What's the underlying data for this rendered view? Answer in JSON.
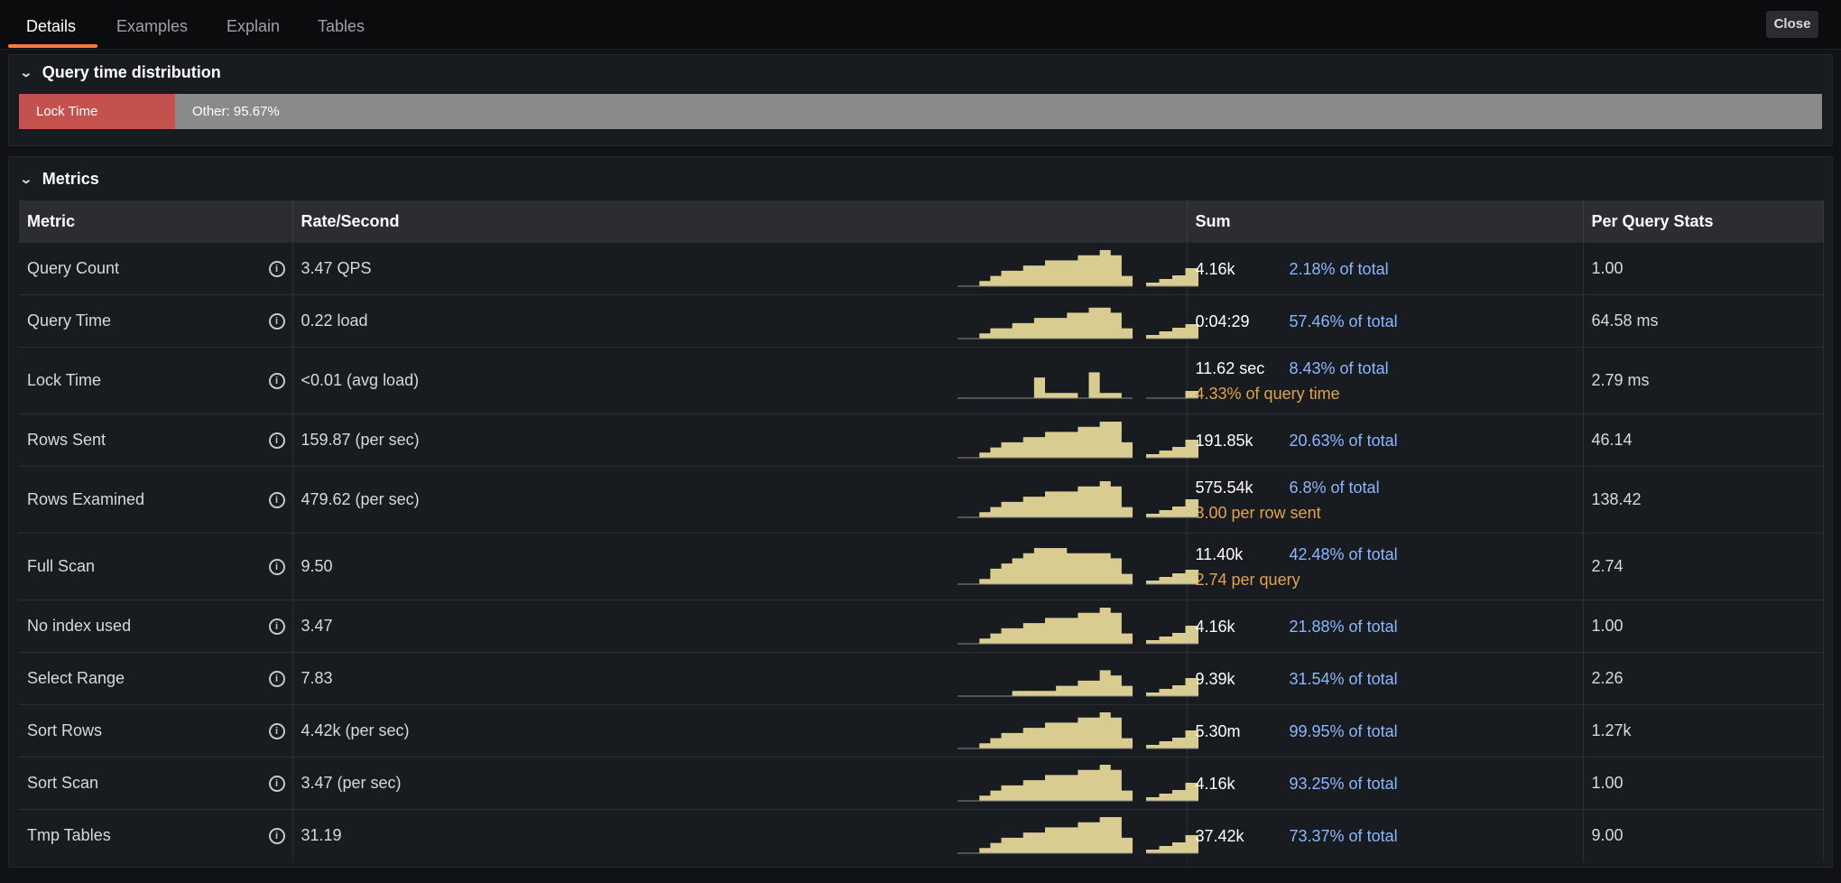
{
  "tabs": [
    {
      "label": "Details",
      "active": true
    },
    {
      "label": "Examples",
      "active": false
    },
    {
      "label": "Explain",
      "active": false
    },
    {
      "label": "Tables",
      "active": false
    }
  ],
  "close_label": "Close",
  "query_time_distribution": {
    "title": "Query time distribution",
    "lock_label": "Lock Time",
    "lock_fraction": 0.0433,
    "other_label": "Other: 95.67%",
    "lock_color": "#c4514e",
    "other_color": "#8a8a8a"
  },
  "metrics_panel": {
    "title": "Metrics",
    "columns": [
      "Metric",
      "Rate/Second",
      "Sum",
      "Per Query Stats"
    ],
    "rows": [
      {
        "metric": "Query Count",
        "rate": "3.47 QPS",
        "sum": "4.16k",
        "pct": "2.18% of total",
        "extra": "",
        "per_query": "1.00",
        "spark": [
          0,
          0,
          1,
          2,
          3,
          3,
          4,
          4,
          5,
          5,
          5,
          6,
          6,
          7,
          6,
          2
        ],
        "spark_small": [
          1,
          2,
          3,
          5
        ]
      },
      {
        "metric": "Query Time",
        "rate": "0.22 load",
        "sum": "0:04:29",
        "pct": "57.46% of total",
        "extra": "",
        "per_query": "64.58 ms",
        "spark": [
          0,
          0,
          1,
          2,
          2,
          3,
          3,
          4,
          4,
          4,
          5,
          5,
          6,
          6,
          5,
          2
        ],
        "spark_small": [
          1,
          2,
          3,
          4
        ]
      },
      {
        "metric": "Lock Time",
        "rate": "<0.01 (avg load)",
        "sum": "11.62 sec",
        "pct": "8.43% of total",
        "extra": "4.33% of query time",
        "per_query": "2.79 ms",
        "spark": [
          0,
          0,
          0,
          0,
          0,
          0,
          0,
          4,
          1,
          1,
          1,
          0,
          5,
          1,
          1,
          0
        ],
        "spark_small": [
          0,
          0,
          0,
          2
        ]
      },
      {
        "metric": "Rows Sent",
        "rate": "159.87 (per sec)",
        "sum": "191.85k",
        "pct": "20.63% of total",
        "extra": "",
        "per_query": "46.14",
        "spark": [
          0,
          0,
          1,
          2,
          3,
          3,
          4,
          4,
          5,
          5,
          5,
          6,
          6,
          7,
          7,
          3
        ],
        "spark_small": [
          1,
          2,
          3,
          5
        ]
      },
      {
        "metric": "Rows Examined",
        "rate": "479.62 (per sec)",
        "sum": "575.54k",
        "pct": "6.8% of total",
        "extra": "3.00 per row sent",
        "per_query": "138.42",
        "spark": [
          0,
          0,
          1,
          2,
          3,
          3,
          4,
          4,
          5,
          5,
          5,
          6,
          6,
          7,
          6,
          2
        ],
        "spark_small": [
          1,
          2,
          3,
          5
        ]
      },
      {
        "metric": "Full Scan",
        "rate": "9.50",
        "sum": "11.40k",
        "pct": "42.48% of total",
        "extra": "2.74 per query",
        "per_query": "2.74",
        "spark": [
          0,
          0,
          1,
          3,
          4,
          5,
          6,
          7,
          7,
          7,
          6,
          6,
          6,
          6,
          5,
          2
        ],
        "spark_small": [
          1,
          2,
          3,
          4
        ]
      },
      {
        "metric": "No index used",
        "rate": "3.47",
        "sum": "4.16k",
        "pct": "21.88% of total",
        "extra": "",
        "per_query": "1.00",
        "spark": [
          0,
          0,
          1,
          2,
          3,
          3,
          4,
          4,
          5,
          5,
          5,
          6,
          6,
          7,
          6,
          2
        ],
        "spark_small": [
          1,
          2,
          3,
          5
        ]
      },
      {
        "metric": "Select Range",
        "rate": "7.83",
        "sum": "9.39k",
        "pct": "31.54% of total",
        "extra": "",
        "per_query": "2.26",
        "spark": [
          0,
          0,
          0,
          0,
          0,
          1,
          1,
          1,
          1,
          2,
          2,
          3,
          3,
          5,
          4,
          2
        ],
        "spark_small": [
          1,
          2,
          3,
          5
        ]
      },
      {
        "metric": "Sort Rows",
        "rate": "4.42k (per sec)",
        "sum": "5.30m",
        "pct": "99.95% of total",
        "extra": "",
        "per_query": "1.27k",
        "spark": [
          0,
          0,
          1,
          2,
          3,
          3,
          4,
          4,
          5,
          5,
          5,
          6,
          6,
          7,
          6,
          2
        ],
        "spark_small": [
          1,
          2,
          3,
          5
        ]
      },
      {
        "metric": "Sort Scan",
        "rate": "3.47 (per sec)",
        "sum": "4.16k",
        "pct": "93.25% of total",
        "extra": "",
        "per_query": "1.00",
        "spark": [
          0,
          0,
          1,
          2,
          3,
          3,
          4,
          4,
          5,
          5,
          5,
          6,
          6,
          7,
          6,
          2
        ],
        "spark_small": [
          1,
          2,
          3,
          5
        ]
      },
      {
        "metric": "Tmp Tables",
        "rate": "31.19",
        "sum": "37.42k",
        "pct": "73.37% of total",
        "extra": "",
        "per_query": "9.00",
        "spark": [
          0,
          0,
          1,
          2,
          3,
          3,
          4,
          4,
          5,
          5,
          5,
          6,
          6,
          7,
          7,
          3
        ],
        "spark_small": [
          1,
          2,
          3,
          5
        ]
      }
    ]
  },
  "spark_color": "#d9cc91",
  "spark_line_color": "#8a8a8a"
}
